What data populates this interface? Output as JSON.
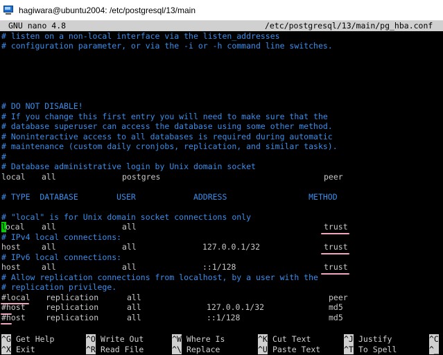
{
  "window": {
    "title": "hagiwara@ubuntu2004: /etc/postgresql/13/main"
  },
  "nano_header": {
    "version": "GNU nano 4.8",
    "file_path": "/etc/postgresql/13/main/pg_hba.conf"
  },
  "buffer": {
    "lines": [
      "# listen on a non-local interface via the listen_addresses",
      "# configuration parameter, or via the -i or -h command line switches.",
      "",
      "",
      "",
      "",
      "",
      "# DO NOT DISABLE!",
      "# If you change this first entry you will need to make sure that the",
      "# database superuser can access the database using some other method.",
      "# Noninteractive access to all databases is required during automatic",
      "# maintenance (custom daily cronjobs, replication, and similar tasks).",
      "#",
      "# Database administrative login by Unix domain socket",
      "",
      "",
      "# TYPE  DATABASE        USER            ADDRESS                 METHOD",
      "",
      "# \"local\" is for Unix domain socket connections only",
      "",
      "# IPv4 local connections:",
      "",
      "# IPv6 local connections:",
      "",
      "# Allow replication connections from localhost, by a user with the",
      "# replication privilege."
    ],
    "rows": [
      {
        "line": 14,
        "type": "local",
        "database": "all",
        "user": "postgres",
        "address": "",
        "method": "peer"
      },
      {
        "line": 19,
        "type": "ocal",
        "type_cursor": "l",
        "database": "all",
        "user": "all",
        "address": "",
        "method": "trust"
      },
      {
        "line": 21,
        "type": "host",
        "database": "all",
        "user": "all",
        "address": "127.0.0.1/32",
        "method": "trust"
      },
      {
        "line": 23,
        "type": "host",
        "database": "all",
        "user": "all",
        "address": "::1/128",
        "method": "trust"
      },
      {
        "line": 26,
        "type": "#local",
        "database": "replication",
        "user": "all",
        "address": "",
        "method": "peer"
      },
      {
        "line": 27,
        "type": "#host",
        "database": "replication",
        "user": "all",
        "address": "127.0.0.1/32",
        "method": "md5"
      },
      {
        "line": 28,
        "type": "#host",
        "database": "replication",
        "user": "all",
        "address": "::1/128",
        "method": "md5"
      }
    ]
  },
  "shortcuts": [
    {
      "key": "^G",
      "label": "Get Help"
    },
    {
      "key": "^O",
      "label": "Write Out"
    },
    {
      "key": "^W",
      "label": "Where Is"
    },
    {
      "key": "^K",
      "label": "Cut Text"
    },
    {
      "key": "^J",
      "label": "Justify"
    },
    {
      "key": "^C",
      "label": ""
    },
    {
      "key": "^X",
      "label": "Exit"
    },
    {
      "key": "^R",
      "label": "Read File"
    },
    {
      "key": "^\\",
      "label": "Replace"
    },
    {
      "key": "^U",
      "label": "Paste Text"
    },
    {
      "key": "^T",
      "label": "To Spell"
    },
    {
      "key": "^_",
      "label": ""
    }
  ],
  "colors": {
    "comment": "#3b8eea",
    "text": "#c8c8c8",
    "header_bg": "#d0d0d0",
    "cursor": "#00d000",
    "annotation": "#f4a6c0"
  }
}
